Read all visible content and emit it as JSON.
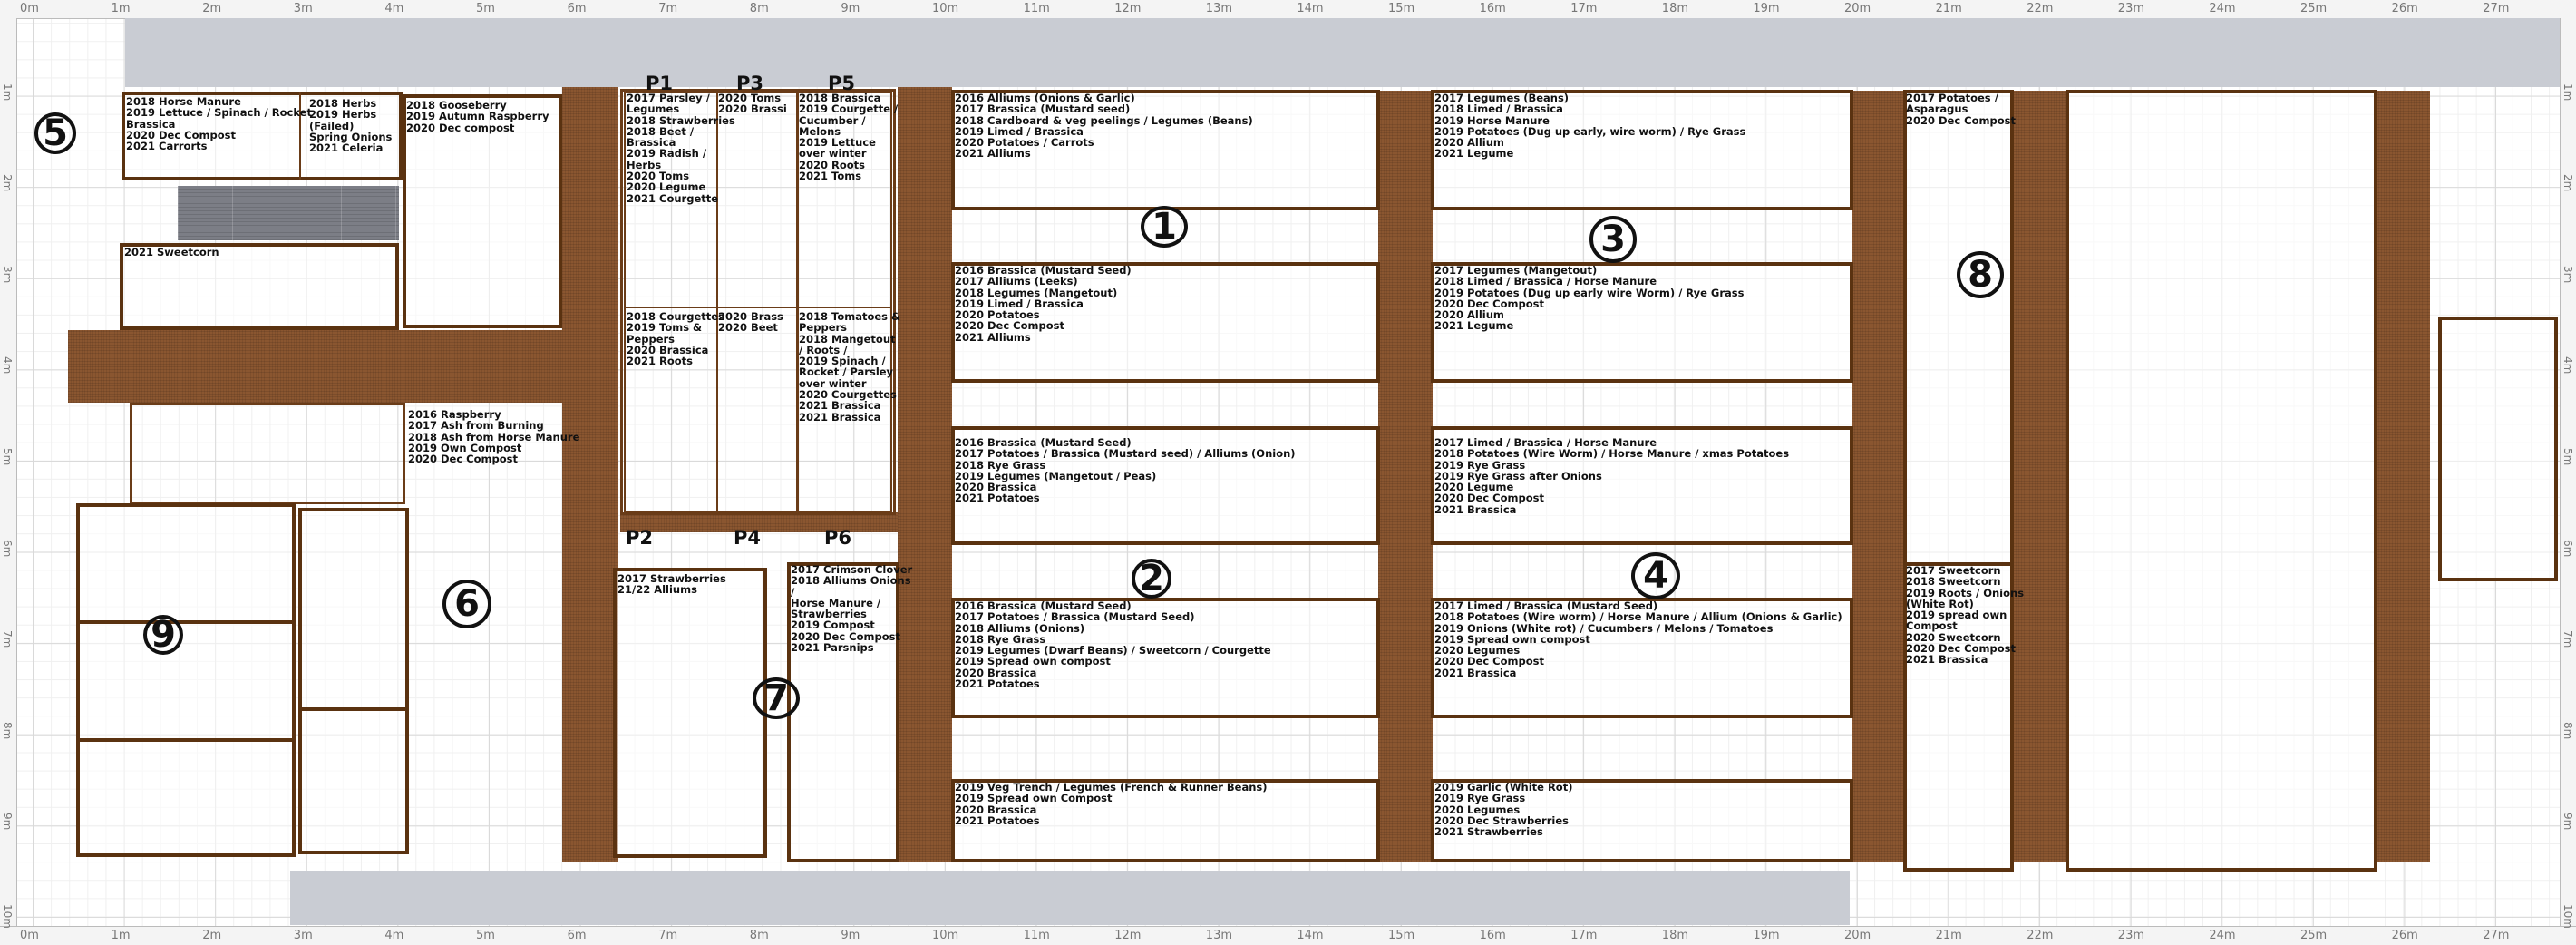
{
  "ruler": {
    "top": [
      "0m",
      "1m",
      "2m",
      "3m",
      "4m",
      "5m",
      "6m",
      "7m",
      "8m",
      "9m",
      "10m",
      "11m",
      "12m",
      "13m",
      "14m",
      "15m",
      "16m",
      "17m",
      "18m",
      "19m",
      "20m",
      "21m",
      "22m",
      "23m",
      "24m",
      "25m",
      "26m",
      "27m"
    ],
    "side": [
      "1m",
      "2m",
      "3m",
      "4m",
      "5m",
      "6m",
      "7m",
      "8m",
      "9m",
      "10m"
    ]
  },
  "colors": {
    "path_brown": "#8a5630",
    "bed_border": "#5a3210",
    "hard_standing": "#c9ccd3"
  },
  "plot_numbers": {
    "n1": "1",
    "n2": "2",
    "n3": "3",
    "n4": "4",
    "n5": "5",
    "n6": "6",
    "n7": "7",
    "n8": "8",
    "n9": "9"
  },
  "poly_labels": {
    "p1": "P1",
    "p2": "P2",
    "p3": "P3",
    "p4": "P4",
    "p5": "P5",
    "p6": "P6"
  },
  "beds": {
    "b5": "2018 Horse Manure\n2019 Lettuce / Spinach / Rocket\nBrassica\n2020 Dec Compost\n2021 Carrorts",
    "b5h": "2018 Herbs\n2019 Herbs\n(Failed)\nSpring Onions\n2021 Celeria",
    "sweetcorn": "2021 Sweetcorn",
    "goose": "2018 Gooseberry\n2019 Autumn Raspberry\n2020 Dec compost",
    "rasp": "2016 Raspberry\n2017 Ash from Burning\n2018 Ash from Horse Manure\n2019 Own Compost\n2020 Dec Compost",
    "p1": "2017 Parsley /\nLegumes\n2018 Strawberries\n2018 Beet /\nBrassica\n2019 Radish /\nHerbs\n2020 Toms\n2020 Legume\n2021 Courgette",
    "p3": "2020 Toms\n2020 Brassi",
    "p5": "2018 Brassica\n2019 Courgette /\nCucumber /\nMelons\n2019 Lettuce\nover winter\n2020 Roots\n2021 Toms",
    "p2": "2018 Courgettes\n2019 Toms &\nPeppers\n2020 Brassica\n2021 Roots",
    "p4": "2020 Brass\n2020 Beet",
    "p6": "2018 Tomatoes &\nPeppers\n2018 Mangetout\n/ Roots /\n2019 Spinach /\nRocket / Parsley\nover winter\n2020 Courgettes\n2021 Brassica\n2021 Brassica",
    "straw": "2017 Strawberries\n21/22 Alliums",
    "b7": "2017 Crimson Clover\n2018 Alliums Onions\n/\nHorse Manure /\nStrawberries\n2019 Compost\n2020 Dec Compost\n2021 Parsnips",
    "a1": "2016 Alliums (Onions & Garlic)\n2017 Brassica (Mustard seed)\n2018 Cardboard & veg peelings / Legumes (Beans)\n2019 Limed / Brassica\n2020 Potatoes / Carrots\n2021 Alliums",
    "a2": "2016 Brassica (Mustard Seed)\n2017 Alliums (Leeks)\n2018 Legumes (Mangetout)\n2019 Limed / Brassica\n2020 Potatoes\n2020 Dec Compost\n2021 Alliums",
    "a3": "2016 Brassica (Mustard Seed)\n2017 Potatoes / Brassica (Mustard seed) / Alliums (Onion)\n2018 Rye Grass\n2019 Legumes (Mangetout / Peas)\n2020 Brassica\n2021 Potatoes",
    "a4": "2016 Brassica (Mustard Seed)\n2017 Potatoes / Brassica (Mustard Seed)\n2018 Alliums (Onions)\n2018 Rye Grass\n2019 Legumes (Dwarf Beans) / Sweetcorn / Courgette\n2019 Spread own compost\n2020 Brassica\n2021 Potatoes",
    "a5": "2019 Veg Trench / Legumes (French & Runner Beans)\n2019 Spread own Compost\n2020 Brassica\n2021 Potatoes",
    "c1": "2017 Legumes (Beans)\n2018 Limed / Brassica\n2019 Horse Manure\n2019 Potatoes (Dug up early, wire worm) / Rye Grass\n2020 Allium\n2021 Legume",
    "c2": "2017 Legumes (Mangetout)\n2018 Limed / Brassica / Horse Manure\n2019 Potatoes (Dug up early wire Worm) / Rye Grass\n2020 Dec Compost\n2020 Allium\n2021 Legume",
    "c3": "2017 Limed / Brassica / Horse Manure\n2018 Potatoes (Wire Worm) / Horse Manure / xmas Potatoes\n2019 Rye Grass\n2019 Rye Grass after Onions\n2020 Legume\n2020 Dec Compost\n2021 Brassica",
    "c4": "2017 Limed / Brassica (Mustard Seed)\n2018 Potatoes (Wire worm) / Horse Manure / Allium (Onions & Garlic)\n2019 Onions (White rot) / Cucumbers / Melons / Tomatoes\n2019 Spread own compost\n2020 Legumes\n2020 Dec Compost\n2021 Brassica",
    "c5": "2019 Garlic (White Rot)\n2019 Rye Grass\n2020 Legumes\n2020 Dec Strawberries\n2021 Strawberries",
    "s8a": "2017 Potatoes /\nAsparagus\n2020 Dec Compost",
    "s8b": "2017 Sweetcorn\n2018 Sweetcorn\n2019 Roots / Onions\n(White Rot)\n2019 spread own\nCompost\n2020 Sweetcorn\n2020 Dec Compost\n2021 Brassica"
  }
}
